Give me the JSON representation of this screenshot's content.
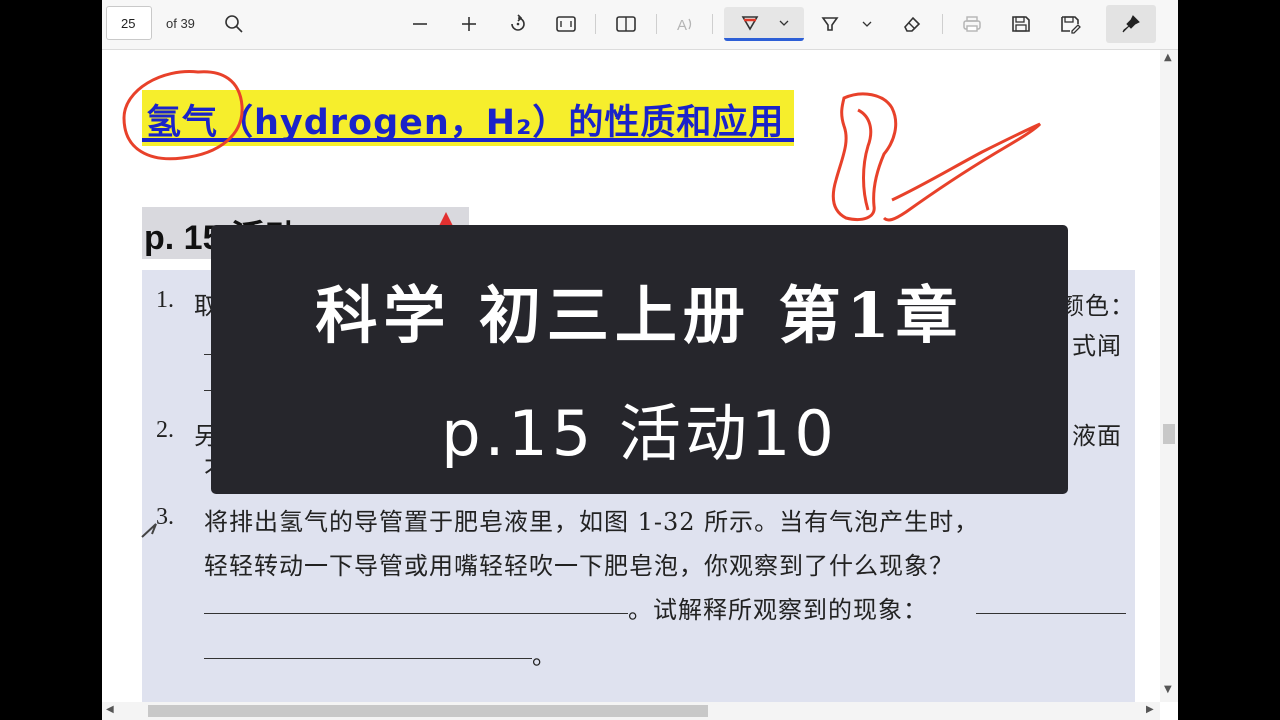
{
  "toolbar": {
    "page_number": "25",
    "page_total": "of 39",
    "icons": [
      "search-icon",
      "zoom-out-icon",
      "zoom-in-icon",
      "rotate-icon",
      "fit-page-icon",
      "page-view-icon",
      "read-aloud-icon",
      "draw-icon",
      "chevron-down-icon",
      "highlight-icon",
      "chevron-down-icon",
      "eraser-icon",
      "print-icon",
      "save-icon",
      "save-as-icon",
      "pin-icon"
    ]
  },
  "document": {
    "heading": "氢气（hydrogen，H₂）的性质和应用",
    "section_label": "p. 15  活动 10",
    "questions": [
      {
        "number": "1.",
        "lines": [
          "取",
          "",
          ""
        ],
        "right_fragments": [
          "颜色：",
          "式闻"
        ]
      },
      {
        "number": "2.",
        "lines": [
          "另",
          "不"
        ],
        "right_fragments": [
          "液面"
        ]
      },
      {
        "number": "3.",
        "lines": [
          "将排出氢气的导管置于肥皂液里，如图 1-32 所示。当有气泡产生时，",
          "轻轻转动一下导管或用嘴轻轻吹一下肥皂泡，你观察到了什么现象？",
          "。试解释所观察到的现象：",
          "。"
        ]
      }
    ]
  },
  "overlay": {
    "title": "科学 初三上册 第1章",
    "subtitle": "p.15  活动10"
  },
  "colors": {
    "heading_highlight": "#f6ee2c",
    "heading_text": "#1a23c9",
    "question_bg": "#dfe2ef",
    "overlay_bg": "#26262c",
    "annotation_ink": "#e8412a"
  }
}
